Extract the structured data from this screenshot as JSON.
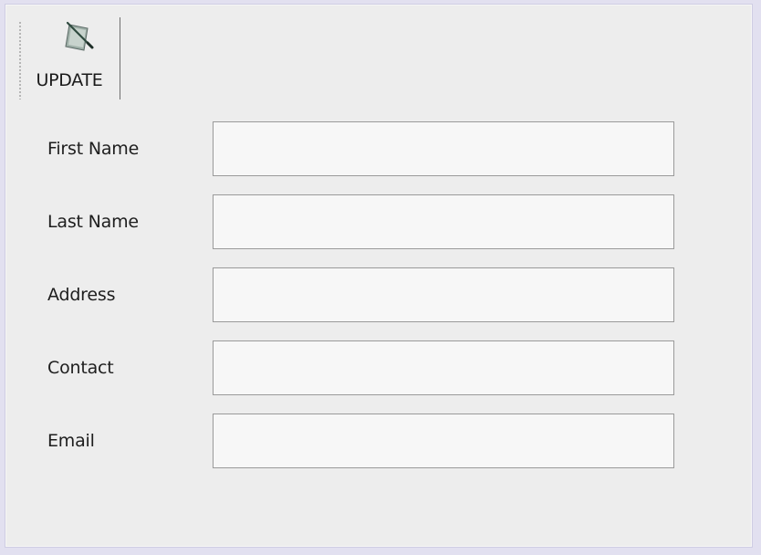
{
  "toolbar": {
    "update_label": "UPDATE",
    "update_icon": "pen-paper-icon"
  },
  "form": {
    "fields": [
      {
        "label": "First Name",
        "value": ""
      },
      {
        "label": "Last Name",
        "value": ""
      },
      {
        "label": "Address",
        "value": ""
      },
      {
        "label": "Contact",
        "value": ""
      },
      {
        "label": "Email",
        "value": ""
      }
    ]
  },
  "colors": {
    "window_background": "#ededed",
    "frame_border": "#cfcde3",
    "input_background": "#f7f7f7",
    "input_border": "#9a9a9a"
  }
}
